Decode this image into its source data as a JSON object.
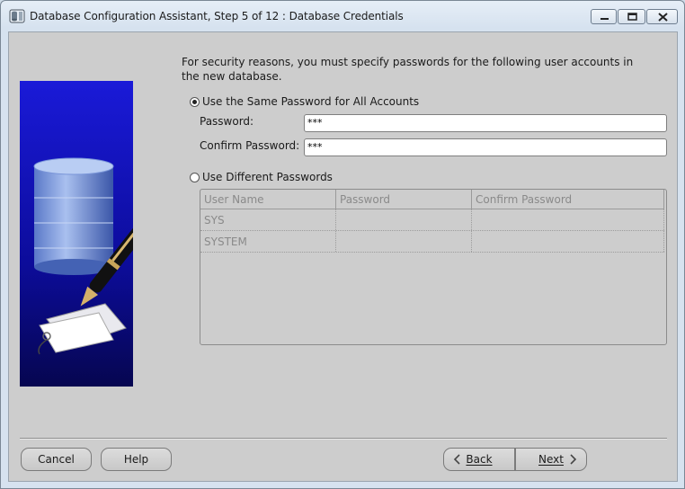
{
  "window": {
    "title": "Database Configuration Assistant, Step 5 of 12 : Database Credentials"
  },
  "intro_text": "For security reasons, you must specify passwords for the following user accounts in the new database.",
  "options": {
    "same_password": {
      "label": "Use the Same Password for All Accounts",
      "selected": true
    },
    "different_passwords": {
      "label": "Use Different Passwords",
      "selected": false
    }
  },
  "fields": {
    "password": {
      "label": "Password:",
      "value": "***"
    },
    "confirm_password": {
      "label": "Confirm Password:",
      "value": "***"
    }
  },
  "accounts_table": {
    "columns": [
      "User Name",
      "Password",
      "Confirm Password"
    ],
    "rows": [
      {
        "user": "SYS",
        "password": "",
        "confirm": ""
      },
      {
        "user": "SYSTEM",
        "password": "",
        "confirm": ""
      }
    ]
  },
  "buttons": {
    "cancel": "Cancel",
    "help": "Help",
    "back": "Back",
    "next": "Next"
  },
  "colors": {
    "panel": "#cdcdcd",
    "image_bg": "#0a0a8a"
  }
}
